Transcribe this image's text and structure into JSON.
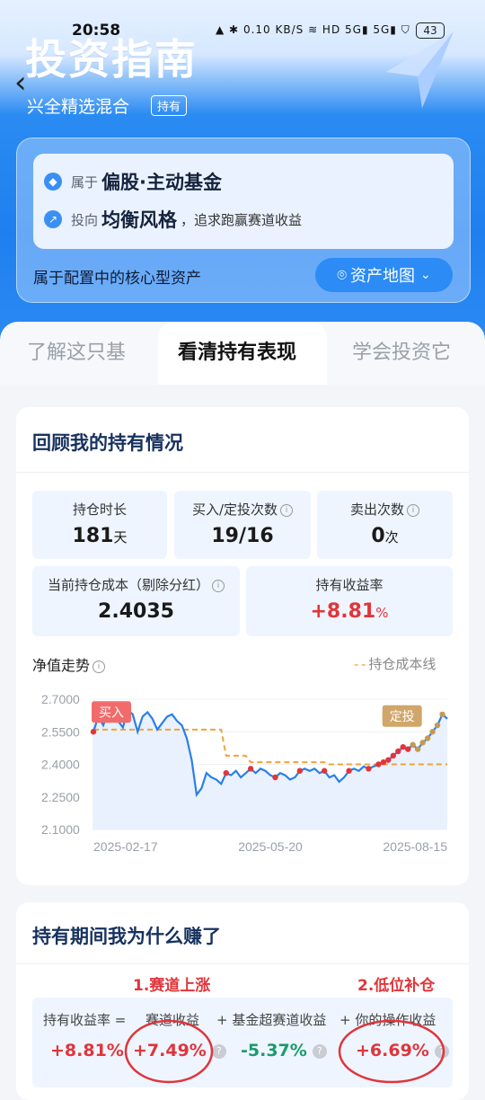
{
  "status_bar": {
    "time": "20:58",
    "net_speed": "0.10 KB/S",
    "battery": "43"
  },
  "header": {
    "title": "投资指南",
    "fund_name": "兴全精选混合",
    "hold_tag": "持有"
  },
  "fund_type": {
    "row1_prefix": "属于",
    "row1_value": "偏股·主动基金",
    "row2_prefix": "投向",
    "row2_value": "均衡风格",
    "row2_tail": "，追求跑赢赛道收益",
    "core_text": "属于配置中的核心型资产",
    "map_button": "资产地图"
  },
  "tabs": [
    {
      "label": "了解这只基"
    },
    {
      "label": "看清持有表现"
    },
    {
      "label": "学会投资它"
    }
  ],
  "holding": {
    "title": "回顾我的持有情况",
    "stats": [
      {
        "label": "持仓时长",
        "value": "181",
        "unit": "天"
      },
      {
        "label": "买入/定投次数",
        "value": "19/16",
        "unit": ""
      },
      {
        "label": "卖出次数",
        "value": "0",
        "unit": "次"
      },
      {
        "label": "当前持仓成本（剔除分红）",
        "value": "2.4035",
        "unit": ""
      },
      {
        "label": "持有收益率",
        "value": "+8.81",
        "unit": "%"
      }
    ],
    "chart_title": "净值走势",
    "legend_cost": "持仓成本线",
    "tag_buy": "买入",
    "tag_dca": "定投"
  },
  "chart_data": {
    "type": "line",
    "ylim": [
      2.1,
      2.7
    ],
    "y_ticks": [
      "2.7000",
      "2.5500",
      "2.4000",
      "2.2500",
      "2.1000"
    ],
    "x_ticks": [
      "2025-02-17",
      "2025-05-20",
      "2025-08-15"
    ],
    "series": [
      {
        "values": [
          2.55,
          2.62,
          2.58,
          2.64,
          2.66,
          2.6,
          2.57,
          2.65,
          2.63,
          2.55,
          2.62,
          2.64,
          2.61,
          2.56,
          2.59,
          2.62,
          2.63,
          2.6,
          2.58,
          2.52,
          2.42,
          2.26,
          2.29,
          2.36,
          2.34,
          2.33,
          2.31,
          2.36,
          2.35,
          2.37,
          2.34,
          2.36,
          2.38,
          2.36,
          2.38,
          2.37,
          2.35,
          2.34,
          2.36,
          2.35,
          2.33,
          2.34,
          2.37,
          2.38,
          2.37,
          2.38,
          2.36,
          2.37,
          2.34,
          2.35,
          2.32,
          2.34,
          2.37,
          2.38,
          2.37,
          2.39,
          2.38,
          2.39,
          2.4,
          2.41,
          2.42,
          2.44,
          2.46,
          2.48,
          2.47,
          2.49,
          2.47,
          2.5,
          2.52,
          2.55,
          2.58,
          2.63,
          2.61
        ]
      },
      {
        "name": "持仓成本线",
        "values": [
          2.56,
          2.56,
          2.56,
          2.56,
          2.56,
          2.56,
          2.56,
          2.56,
          2.56,
          2.56,
          2.56,
          2.56,
          2.56,
          2.56,
          2.56,
          2.56,
          2.56,
          2.56,
          2.56,
          2.56,
          2.56,
          2.56,
          2.56,
          2.56,
          2.56,
          2.56,
          2.56,
          2.44,
          2.44,
          2.44,
          2.44,
          2.44,
          2.41,
          2.41,
          2.41,
          2.41,
          2.41,
          2.41,
          2.41,
          2.41,
          2.41,
          2.41,
          2.41,
          2.41,
          2.41,
          2.41,
          2.41,
          2.41,
          2.4,
          2.4,
          2.4,
          2.4,
          2.4,
          2.4,
          2.4,
          2.4,
          2.4,
          2.4,
          2.4,
          2.4,
          2.4,
          2.4,
          2.4,
          2.4,
          2.4,
          2.4,
          2.4,
          2.4,
          2.4,
          2.4,
          2.4,
          2.4,
          2.4
        ]
      }
    ],
    "buy_points": [
      0,
      27,
      32,
      37,
      42,
      47,
      52,
      56,
      58,
      59,
      60,
      61,
      62,
      63,
      64
    ],
    "dca_points": [
      65,
      66,
      67,
      68,
      69,
      70,
      71
    ]
  },
  "earnings": {
    "title": "持有期间我为什么赚了",
    "annotation_1": "1.赛道上涨",
    "annotation_2": "2.低位补仓",
    "items": [
      {
        "label": "持有收益率 =",
        "value": "+8.81%"
      },
      {
        "label": "赛道收益",
        "value": "+7.49%"
      },
      {
        "label": "+ 基金超赛道收益",
        "value": "-5.37%"
      },
      {
        "label": "+ 你的操作收益",
        "value": "+6.69%"
      }
    ]
  },
  "colors": {
    "accent": "#1f7fef",
    "up": "#e0353b",
    "down": "#1a9b6a",
    "cost_line": "#f0a33a"
  }
}
